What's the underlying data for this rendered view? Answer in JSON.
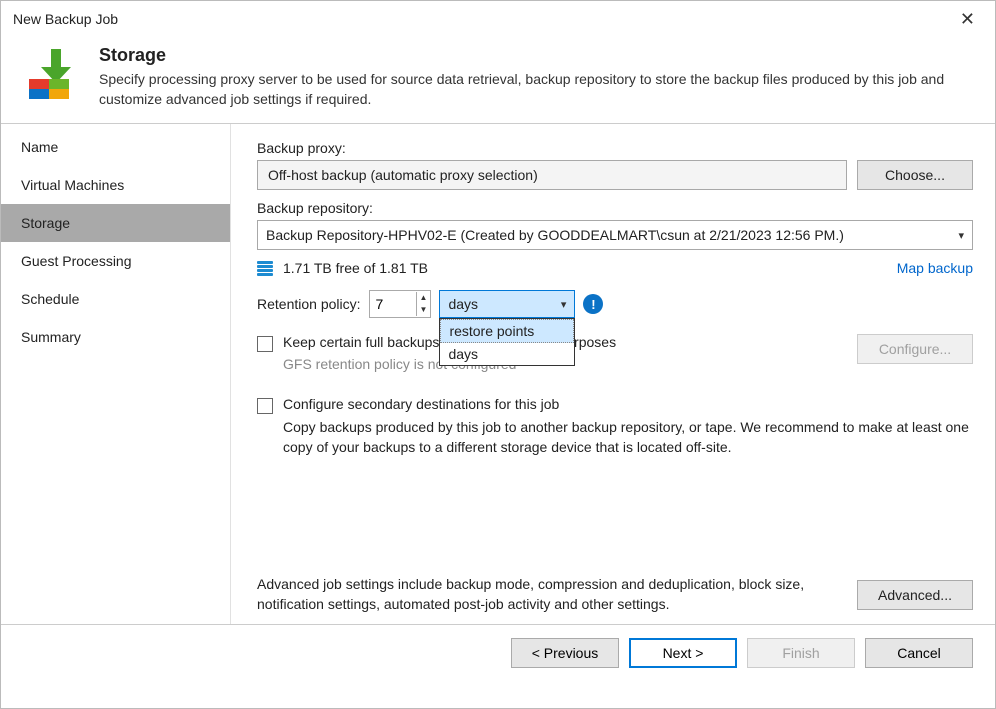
{
  "window": {
    "title": "New Backup Job"
  },
  "header": {
    "title": "Storage",
    "desc": "Specify processing proxy server to be used for source data retrieval, backup repository to store the backup files produced by this job and customize advanced job settings if required."
  },
  "sidebar": {
    "items": [
      {
        "label": "Name"
      },
      {
        "label": "Virtual Machines"
      },
      {
        "label": "Storage"
      },
      {
        "label": "Guest Processing"
      },
      {
        "label": "Schedule"
      },
      {
        "label": "Summary"
      }
    ],
    "active_index": 2
  },
  "main": {
    "proxy_label": "Backup proxy:",
    "proxy_value": "Off-host backup (automatic proxy selection)",
    "choose_btn": "Choose...",
    "repo_label": "Backup repository:",
    "repo_value": "Backup Repository-HPHV02-E (Created by GOODDEALMART\\csun at 2/21/2023 12:56 PM.)",
    "free_text": "1.71 TB free of 1.81 TB",
    "map_backup": "Map backup",
    "retention_label": "Retention policy:",
    "retention_value": "7",
    "retention_unit": "days",
    "dropdown_options": [
      "restore points",
      "days"
    ],
    "gfs_check_label": "Keep certain full backups longer for archival purposes",
    "gfs_sub": "GFS retention policy is not configured",
    "configure_btn": "Configure...",
    "sec_check_label": "Configure secondary destinations for this job",
    "sec_desc": "Copy backups produced by this job to another backup repository, or tape. We recommend to make at least one copy of your backups to a different storage device that is located off-site.",
    "adv_text": "Advanced job settings include backup mode, compression and deduplication, block size, notification settings, automated post-job activity and other settings.",
    "advanced_btn": "Advanced..."
  },
  "footer": {
    "previous": "< Previous",
    "next": "Next >",
    "finish": "Finish",
    "cancel": "Cancel"
  }
}
